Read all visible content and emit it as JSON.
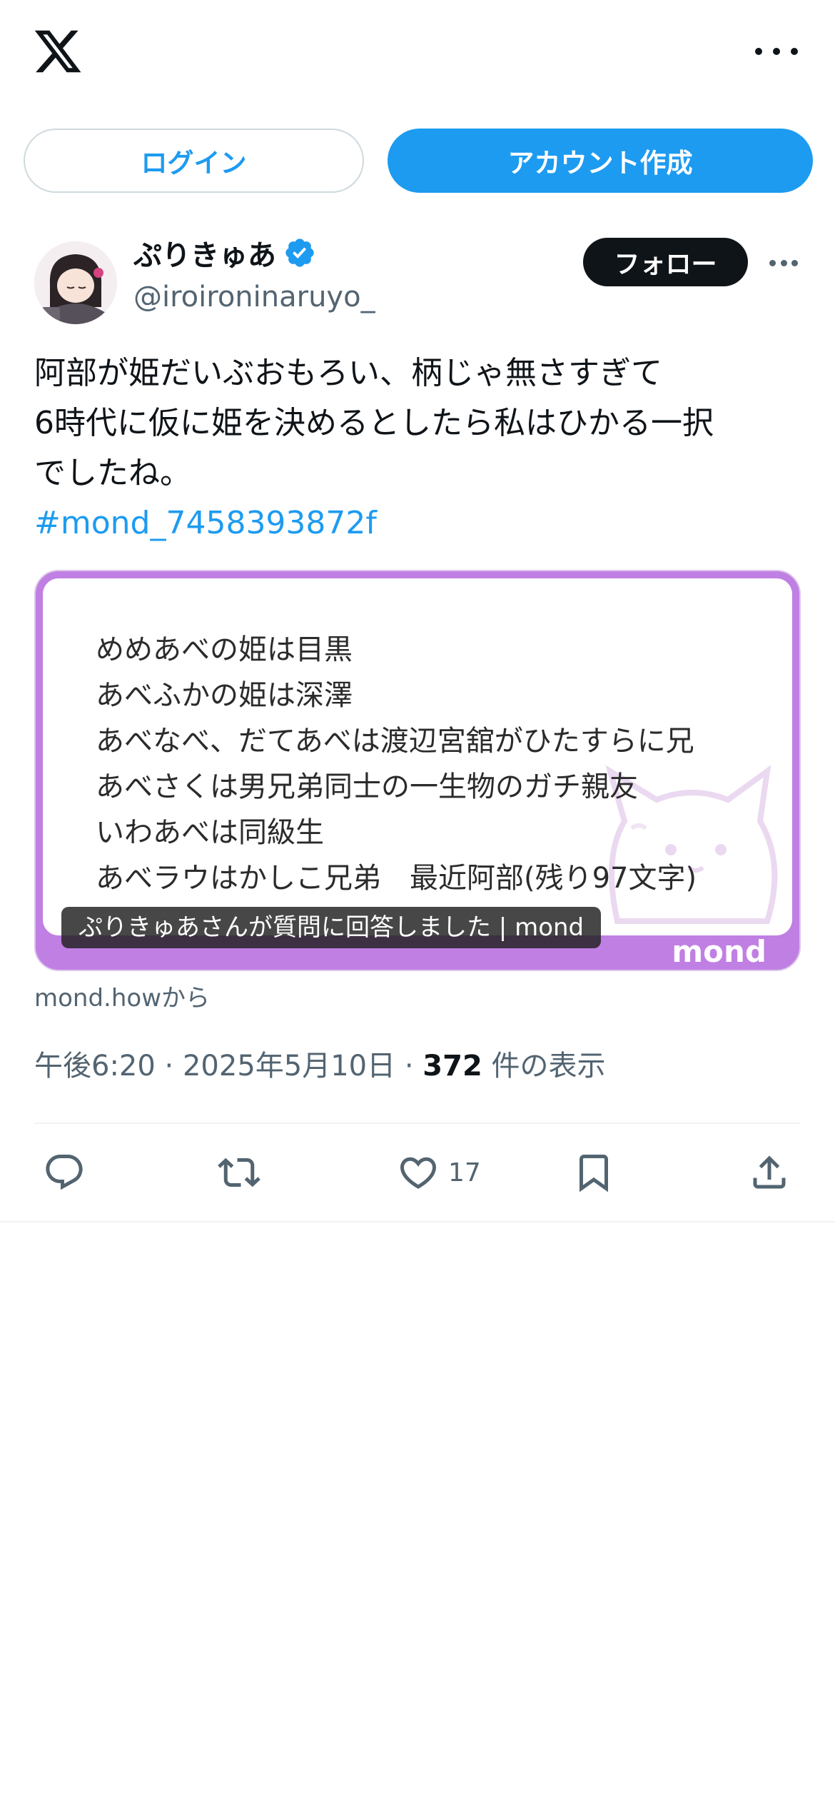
{
  "header": {
    "logo_icon": "x-logo-icon",
    "more_icon": "more-horizontal-icon"
  },
  "auth": {
    "login_label": "ログイン",
    "signup_label": "アカウント作成"
  },
  "author": {
    "display_name": "ぷりきゅあ",
    "handle": "@iroironinaruyo_",
    "verified": true,
    "follow_label": "フォロー"
  },
  "tweet": {
    "lines": [
      "阿部が姫だいぶおもろい、柄じゃ無さすぎて",
      "6時代に仮に姫を決めるとしたら私はひかる一択",
      "でしたね。"
    ],
    "hashtag": "#mond_7458393872f"
  },
  "card": {
    "lines": [
      "めめあべの姫は目黒",
      "あべふかの姫は深澤",
      "あべなべ、だてあべは渡辺宮舘がひたすらに兄",
      "あべさくは男兄弟同士の一生物のガチ親友",
      "いわあべは同級生",
      "あべラウはかしこ兄弟　最近阿部(残り97文字)"
    ],
    "caption": "ぷりきゅあさんが質問に回答しました | mond",
    "brand": "mond",
    "source": "mond.howから"
  },
  "meta": {
    "time": "午後6:20",
    "date": "2025年5月10日",
    "views_count": "372",
    "views_label": "件の表示",
    "separator": "·"
  },
  "actions": {
    "like_count": "17"
  },
  "colors": {
    "accent": "#1d9bf0",
    "card_border": "#c07fe3",
    "text_primary": "#0f1419",
    "text_secondary": "#536471"
  }
}
